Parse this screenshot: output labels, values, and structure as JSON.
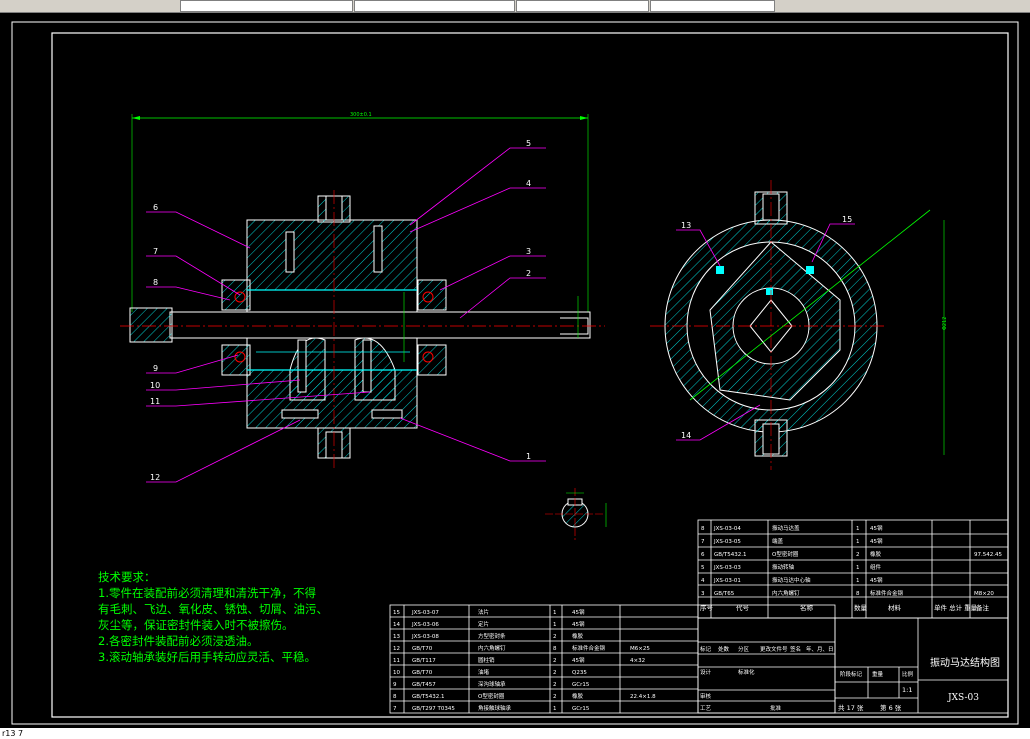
{
  "toolbar": {
    "fields": [
      "",
      "",
      "",
      "",
      ""
    ]
  },
  "status": {
    "left": "r13 7"
  },
  "technical": {
    "title": "技术要求：",
    "lines": [
      "1.零件在装配前必须清理和清洗干净，不得",
      "  有毛刺、飞边、氧化皮、锈蚀、切屑、油污、",
      "  灰尘等，保证密封件装入时不被擦伤。",
      "2.各密封件装配前必须浸透油。",
      "3.滚动轴承装好后用手转动应灵活、平稳。"
    ]
  },
  "drawing": {
    "title": "振动马达结构图",
    "number": "JXS-03",
    "scale": "1:1",
    "sheets": "共 17 张",
    "sheet_no": "第 6 张",
    "material_code": "97.542.45"
  },
  "leaders": [
    "1",
    "2",
    "3",
    "4",
    "5",
    "6",
    "7",
    "8",
    "9",
    "10",
    "11",
    "12",
    "13",
    "14",
    "15"
  ],
  "bom_upper": [
    [
      "8",
      "JXS-03-04",
      "振动马达盖",
      "1",
      "45钢",
      ""
    ],
    [
      "7",
      "JXS-03-05",
      "端盖",
      "1",
      "45钢",
      ""
    ],
    [
      "6",
      "GB/T5432.1",
      "O型密封圈",
      "2",
      "橡胶",
      "97.542.45"
    ],
    [
      "5",
      "JXS-03-03",
      "振动转轴",
      "1",
      "组件",
      ""
    ],
    [
      "4",
      "JXS-03-01",
      "振动马达中心轴",
      "1",
      "45钢",
      ""
    ],
    [
      "3",
      "GB/T65",
      "内六角螺钉",
      "8",
      "标准件合金钢",
      "M8×20"
    ]
  ],
  "bom_upper_header": [
    "序号",
    "代号",
    "名称",
    "数量",
    "材料",
    "单件 总计 重量",
    "备注"
  ],
  "bom_lower": [
    [
      "15",
      "JXS-03-07",
      "法片",
      "1",
      "45钢",
      ""
    ],
    [
      "14",
      "JXS-03-06",
      "定片",
      "1",
      "45钢",
      ""
    ],
    [
      "13",
      "JXS-03-08",
      "方型密封条",
      "2",
      "橡胶",
      ""
    ],
    [
      "12",
      "GB/T70",
      "内六角螺钉",
      "8",
      "标准件合金钢",
      "M6×25"
    ],
    [
      "11",
      "GB/T117",
      "圆柱销",
      "2",
      "45钢",
      "4×32"
    ],
    [
      "10",
      "GB/T70",
      "油堵",
      "2",
      "Q235",
      ""
    ],
    [
      "9",
      "GB/T457",
      "深沟球轴承",
      "2",
      "GCr15",
      ""
    ],
    [
      "8",
      "GB/T5432.1",
      "O型密封圈",
      "2",
      "橡胶",
      "22.4×1.8"
    ],
    [
      "7",
      "GB/T297 T0345",
      "角接触球轴承",
      "1",
      "GCr15",
      ""
    ]
  ],
  "title_block": {
    "labels": [
      "标记",
      "处数",
      "分区",
      "更改文件号",
      "签名",
      "年、月、日",
      "设计",
      "标准化",
      "阶段标记",
      "重量",
      "比例",
      "审核",
      "工艺",
      "批准"
    ]
  },
  "colors": {
    "background": "#000000",
    "outline": "#ffffff",
    "hatch": "#00ffff",
    "center": "#ff0000",
    "leader": "#ff00ff",
    "text": "#00ff00",
    "dim": "#00ff00"
  }
}
